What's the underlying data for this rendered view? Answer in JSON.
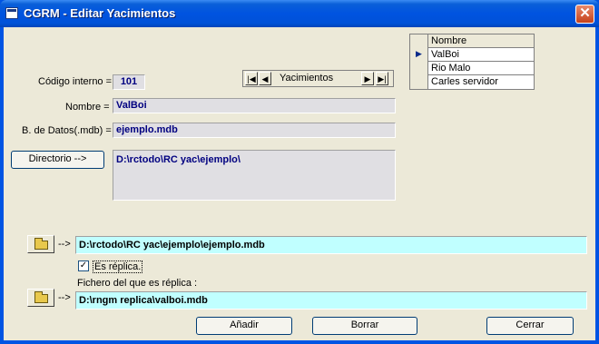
{
  "window": {
    "title": "CGRM - Editar Yacimientos",
    "close_symbol": "✕"
  },
  "form": {
    "codigo_label": "Código interno =",
    "codigo_value": "101",
    "nombre_label": "Nombre =",
    "nombre_value": "ValBoi",
    "bdatos_label": "B. de Datos(.mdb) =",
    "bdatos_value": "ejemplo.mdb",
    "directorio_button": "Directorio -->",
    "directorio_value": "D:\\rctodo\\RC yac\\ejemplo\\",
    "path_arrow": "-->",
    "path_value": "D:\\rctodo\\RC yac\\ejemplo\\ejemplo.mdb",
    "es_replica_label": "Es réplica.",
    "es_replica_checked": true,
    "check_mark": "✓",
    "fichero_label": "Fichero del que es réplica :",
    "replica_arrow": "-->",
    "replica_value": "D:\\rngm replica\\valboi.mdb"
  },
  "navigator": {
    "label": "Yacimientos",
    "first": "|◀",
    "prev": "◀",
    "next": "▶",
    "last": "▶|"
  },
  "grid": {
    "header": "Nombre",
    "current_marker": "▶",
    "rows": [
      "ValBoi",
      "Rio Malo",
      "Carles servidor"
    ]
  },
  "buttons": {
    "add": "Añadir",
    "delete": "Borrar",
    "close": "Cerrar"
  },
  "colors": {
    "title_bar": "#0054e3",
    "client": "#ece9d8",
    "path_field": "#c0ffff",
    "value_text": "#000080"
  }
}
